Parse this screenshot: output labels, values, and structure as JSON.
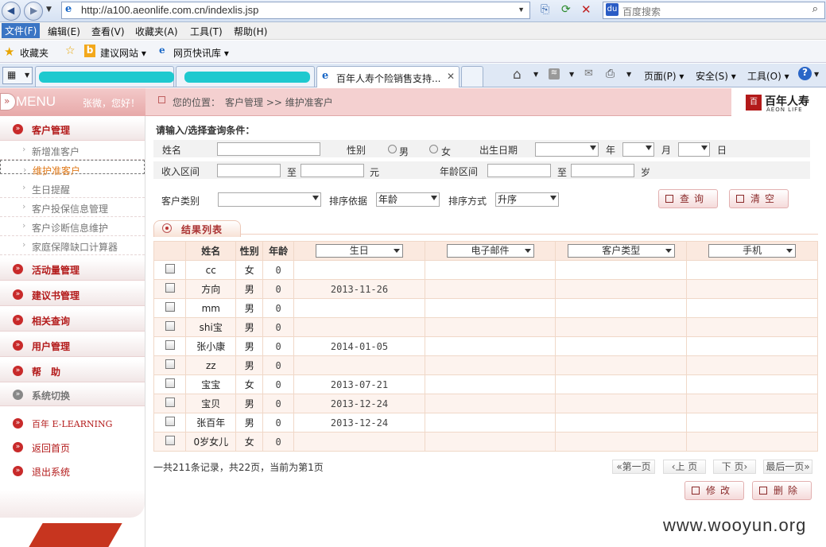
{
  "browser": {
    "url": "http://a100.aeonlife.com.cn/indexlis.jsp",
    "search_placeholder": "百度搜索",
    "menu": [
      "文件(F)",
      "编辑(E)",
      "查看(V)",
      "收藏夹(A)",
      "工具(T)",
      "帮助(H)"
    ],
    "favorites": {
      "label": "收藏夹",
      "links": [
        "建议网站 ▾",
        "网页快讯库 ▾"
      ]
    },
    "tabs": {
      "active_title": "百年人寿个险销售支持..."
    },
    "cmdbar": {
      "page": "页面(P) ▾",
      "safety": "安全(S) ▾",
      "tools": "工具(O) ▾"
    }
  },
  "app": {
    "menu_title": "MENU",
    "greeting": "张微，您好！",
    "breadcrumb": {
      "prefix": "您的位置：",
      "path": "客户管理 >> 维护准客户"
    },
    "logo": {
      "name": "百年人寿",
      "en": "AEON LIFE"
    }
  },
  "sidebar": {
    "sections": [
      "客户管理",
      "活动量管理",
      "建议书管理",
      "相关查询",
      "用户管理",
      "帮　助",
      "系统切换"
    ],
    "subitems": [
      "新增准客户",
      "维护准客户",
      "生日提醒",
      "客户投保信息管理",
      "客户诊断信息维护",
      "家庭保障缺口计算器"
    ],
    "extras": [
      "百年 E-LEARNING",
      "返回首页",
      "退出系统"
    ]
  },
  "filter": {
    "heading": "请输入/选择查询条件：",
    "name_label": "姓名",
    "gender_label": "性别",
    "male": "男",
    "female": "女",
    "birth_label": "出生日期",
    "year": "年",
    "month": "月",
    "day": "日",
    "income_label": "收入区间",
    "to": "至",
    "yuan": "元",
    "age_label": "年龄区间",
    "sui": "岁",
    "category_label": "客户类别",
    "sort_by_label": "排序依据",
    "sort_by_value": "年龄",
    "sort_order_label": "排序方式",
    "sort_order_value": "升序",
    "query_btn": "查询",
    "clear_btn": "清空"
  },
  "results": {
    "tab_label": "结果列表",
    "columns": {
      "name": "姓名",
      "gender": "性别",
      "age": "年龄",
      "birthday": "生日",
      "email": "电子邮件",
      "category": "客户类型",
      "mobile": "手机"
    },
    "rows": [
      {
        "name": "cc",
        "gender": "女",
        "age": "0",
        "birthday": ""
      },
      {
        "name": "方向",
        "gender": "男",
        "age": "0",
        "birthday": "2013-11-26"
      },
      {
        "name": "mm",
        "gender": "男",
        "age": "0",
        "birthday": ""
      },
      {
        "name": "shi宝",
        "gender": "男",
        "age": "0",
        "birthday": ""
      },
      {
        "name": "张小康",
        "gender": "男",
        "age": "0",
        "birthday": "2014-01-05"
      },
      {
        "name": "zz",
        "gender": "男",
        "age": "0",
        "birthday": ""
      },
      {
        "name": "宝宝",
        "gender": "女",
        "age": "0",
        "birthday": "2013-07-21"
      },
      {
        "name": "宝贝",
        "gender": "男",
        "age": "0",
        "birthday": "2013-12-24"
      },
      {
        "name": "张百年",
        "gender": "男",
        "age": "0",
        "birthday": "2013-12-24"
      },
      {
        "name": "0岁女儿",
        "gender": "女",
        "age": "0",
        "birthday": ""
      }
    ],
    "summary": "一共211条记录，共22页，当前为第1页",
    "pager": [
      "«第一页",
      "‹上 页",
      "下 页›",
      "最后一页»"
    ],
    "edit_btn": "修改",
    "delete_btn": "删除"
  },
  "watermark": "www.wooyun.org"
}
